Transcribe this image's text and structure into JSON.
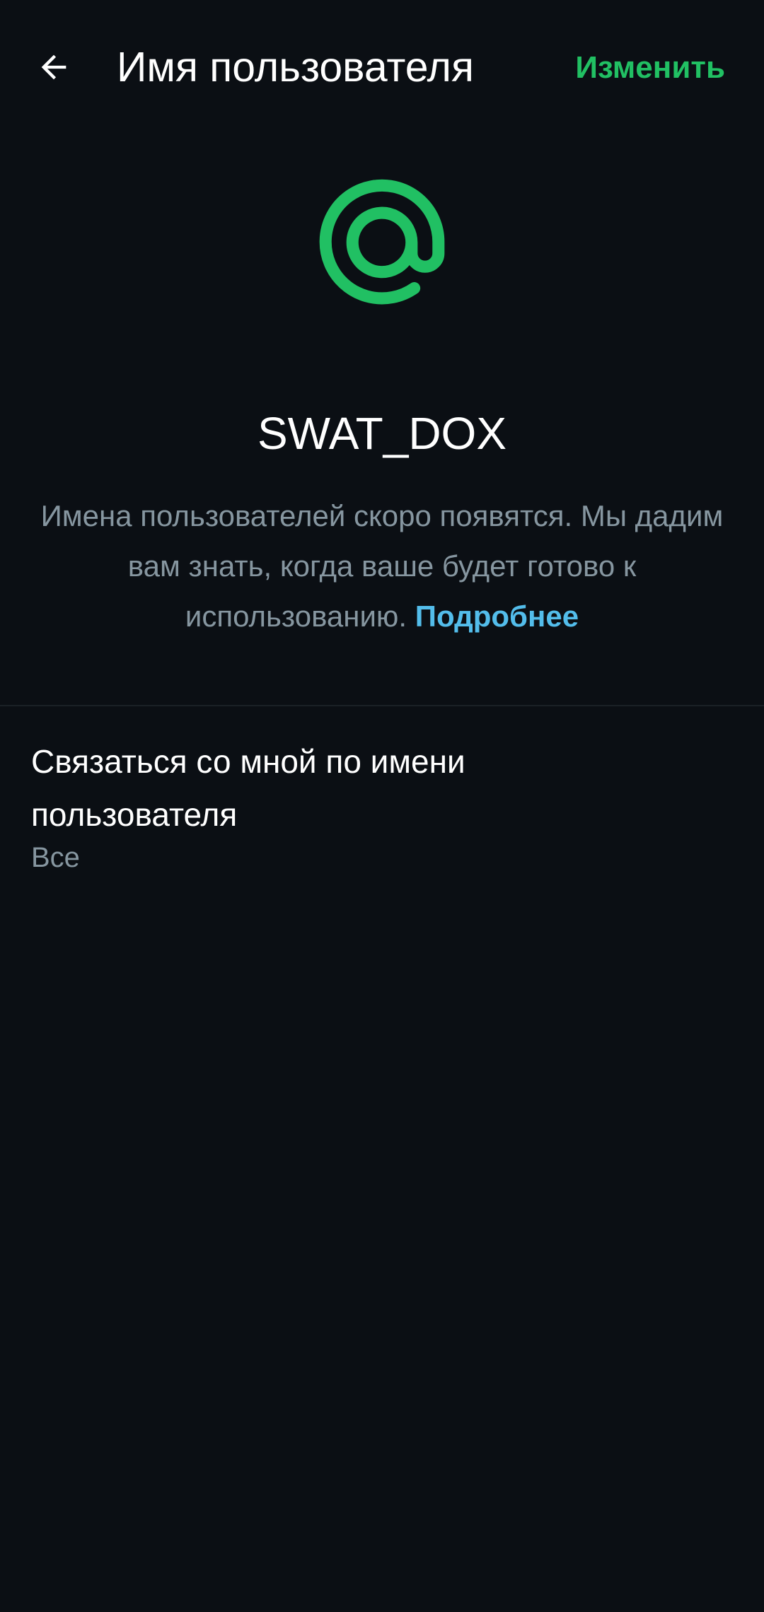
{
  "header": {
    "title": "Имя пользователя",
    "edit_label": "Изменить"
  },
  "icons": {
    "back": "arrow-left-icon",
    "at": "at-sign-icon"
  },
  "colors": {
    "background": "#0b0f14",
    "accent_green": "#21c063",
    "link_blue": "#53bdeb",
    "secondary_text": "#8696a0"
  },
  "profile": {
    "username": "SWAT_DOX"
  },
  "info": {
    "text": "Имена пользователей скоро появятся. Мы дадим вам знать, когда ваше будет готово к использованию. ",
    "link": "Подробнее"
  },
  "settings": {
    "contact_by_username": {
      "title": "Связаться со мной по имени пользователя",
      "value": "Все"
    }
  }
}
